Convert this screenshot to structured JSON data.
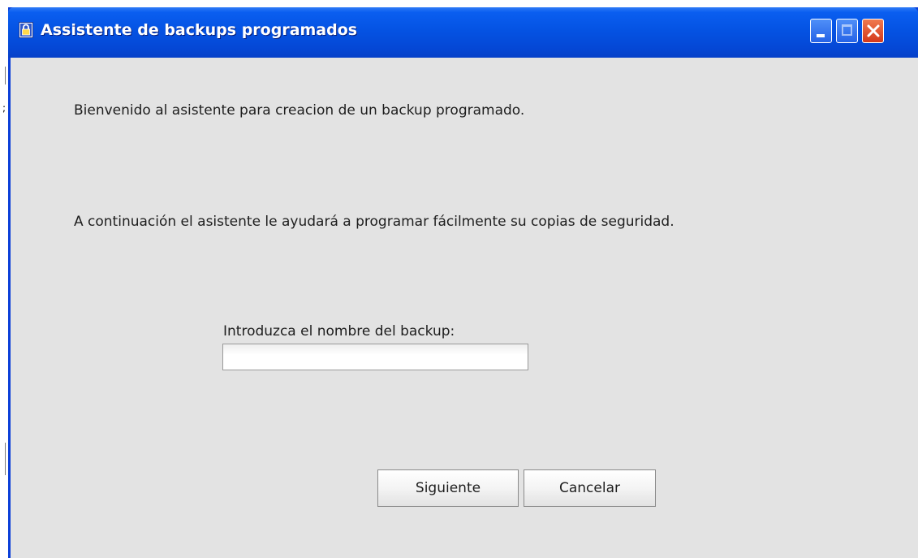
{
  "window": {
    "title": "Assistente de backups programados",
    "titlebar_color": "#0553e3",
    "close_color": "#d4381a",
    "controls": [
      "minimize-icon",
      "maximize-icon",
      "close-icon"
    ]
  },
  "content": {
    "welcome_text": "Bienvenido al asistente para creacion de un backup programado.",
    "intro_text": "A continuación el asistente le ayudará a programar fácilmente su copias de seguridad.",
    "name_label": "Introduzca el nombre del backup:",
    "name_value": "",
    "name_placeholder": ""
  },
  "buttons": {
    "next_label": "Siguiente",
    "cancel_label": "Cancelar"
  },
  "background": {
    "left_mark": ";"
  }
}
